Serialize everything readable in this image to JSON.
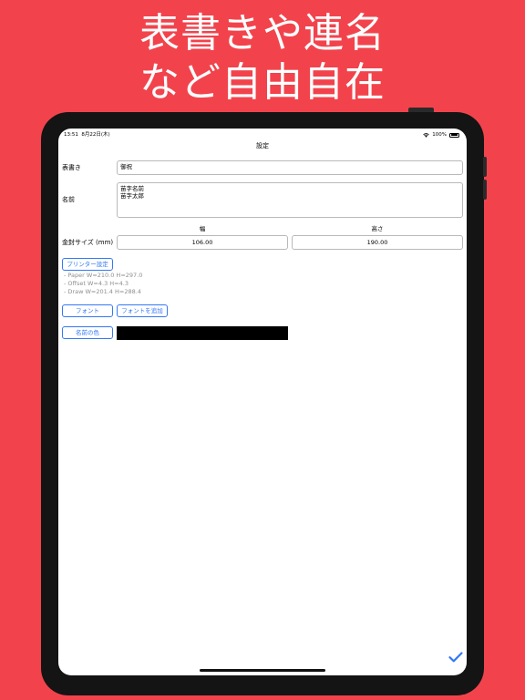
{
  "headline": {
    "line1": "表書きや連名",
    "line2": "など自由自在"
  },
  "status_bar": {
    "time": "13:51",
    "date": "8月22日(木)",
    "battery": "100%"
  },
  "nav": {
    "title": "設定"
  },
  "form": {
    "omote_label": "表書き",
    "omote_value": "御祝",
    "name_label": "名前",
    "name_lines": [
      "苗字名前",
      "苗字太郎"
    ],
    "envelope_label": "金封サイズ (mm)",
    "width_header": "幅",
    "height_header": "高さ",
    "width_value": "106.00",
    "height_value": "190.00"
  },
  "printer": {
    "button": "プリンター設定",
    "info": [
      "- Paper W=210.0 H=297.0",
      "- Offset W=4.3 H=4.3",
      "- Draw W=201.4 H=288.4"
    ]
  },
  "font": {
    "button": "フォント",
    "add_button": "フォントを追加"
  },
  "name_color": {
    "button": "名前の色",
    "value": "#000000"
  },
  "colors": {
    "background": "#f2434c",
    "accent": "#3478f6"
  }
}
